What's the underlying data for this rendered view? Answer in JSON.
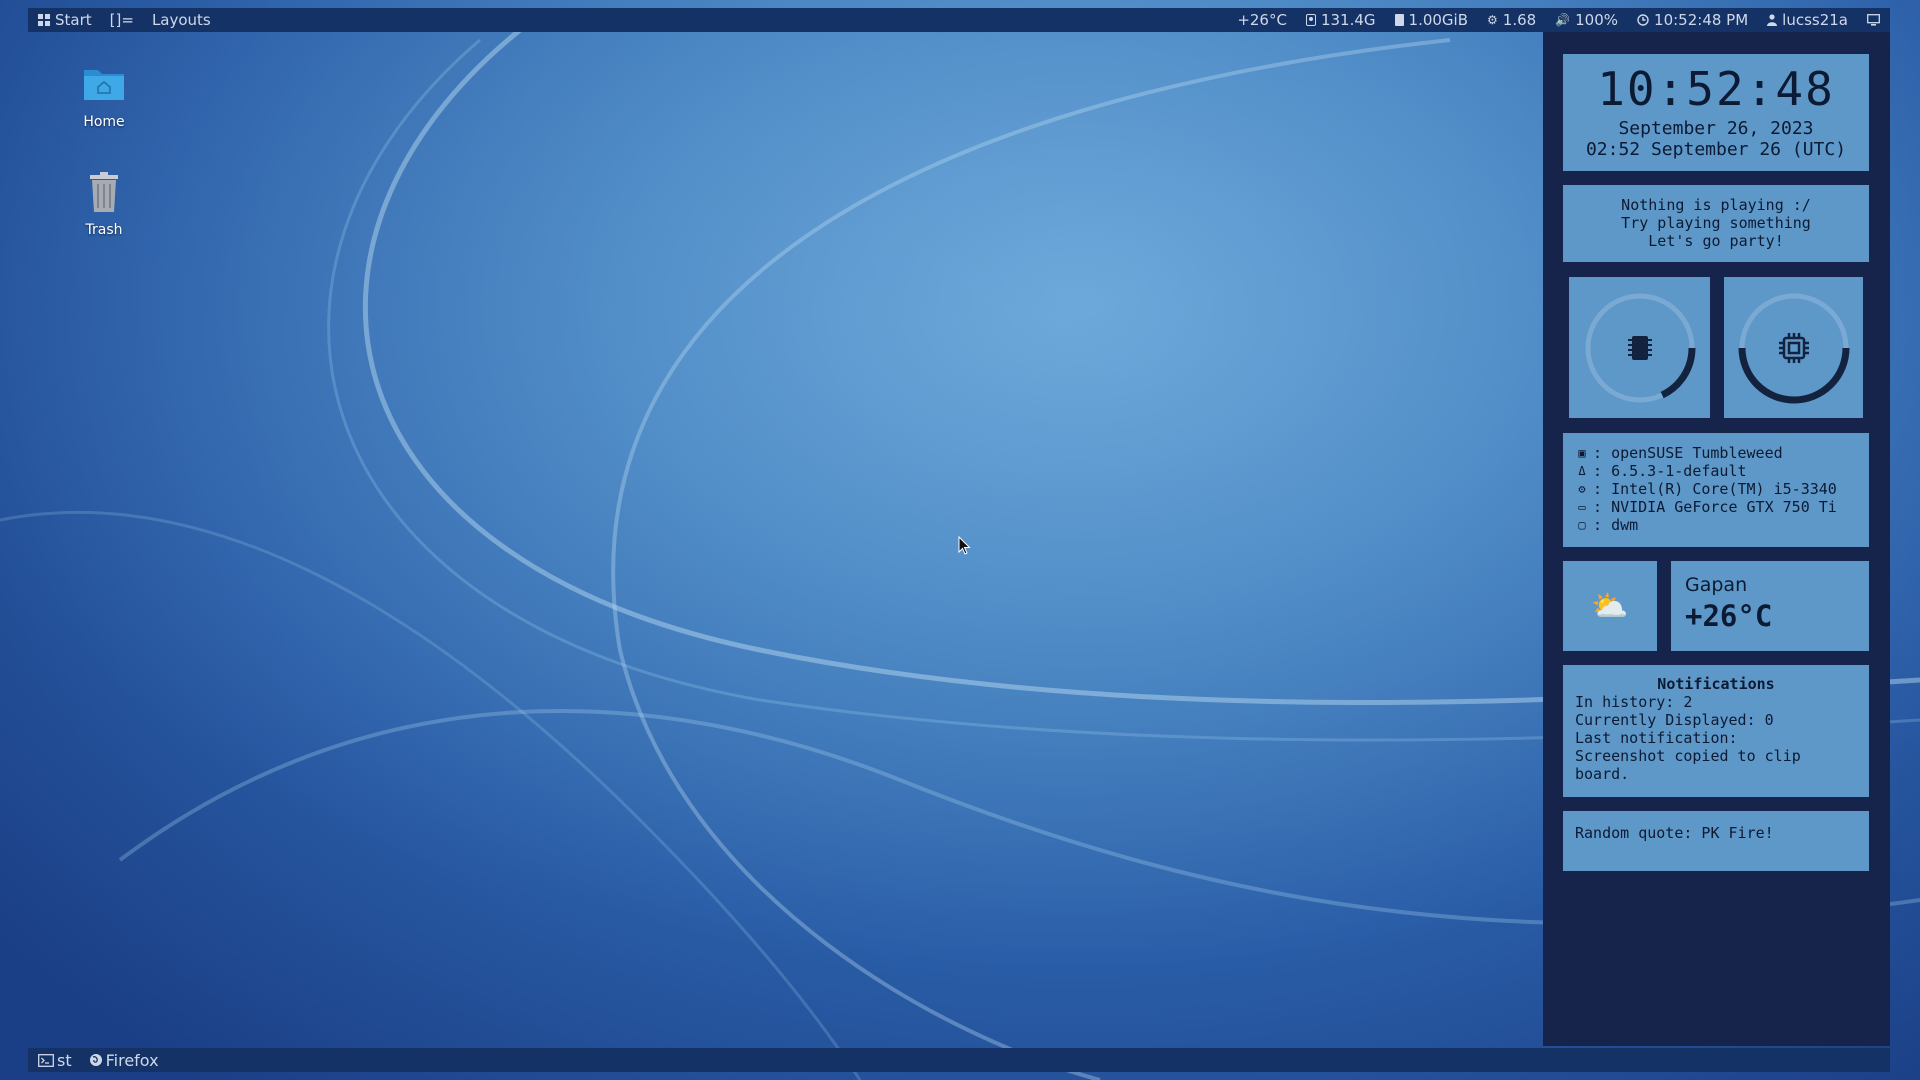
{
  "topbar": {
    "start_label": "Start",
    "layout_symbol": "[]=",
    "layouts_label": "Layouts",
    "temperature": "+26°C",
    "disk": "131.4G",
    "memory": "1.00GiB",
    "load": "1.68",
    "volume": "100%",
    "time": "10:52:48 PM",
    "user": "lucss21a"
  },
  "desktop": {
    "icons": [
      {
        "label": "Home",
        "icon": "folder-home-icon"
      },
      {
        "label": "Trash",
        "icon": "trash-icon"
      }
    ]
  },
  "panel": {
    "clock": {
      "time": "10:52:48",
      "date": "September 26, 2023",
      "utc": "02:52 September 26 (UTC)"
    },
    "music": {
      "line1": "Nothing is playing :/",
      "line2": "Try playing something",
      "line3": "Let's go party!"
    },
    "gauges": {
      "ram_fraction": 0.18,
      "cpu_fraction": 0.5
    },
    "sysinfo": {
      "separator": ":",
      "os": "openSUSE Tumbleweed",
      "kernel": "6.5.3-1-default",
      "cpu": "Intel(R) Core(TM) i5-3340",
      "gpu": "NVIDIA GeForce GTX 750 Ti",
      "wm": "dwm"
    },
    "weather": {
      "icon": "⛅",
      "city": "Gapan",
      "temp": "+26°C"
    },
    "notifications": {
      "title": "Notifications",
      "history": "In history: 2",
      "displayed": "Currently Displayed: 0",
      "last_label": "Last notification:",
      "last_line1": "Screenshot copied to clip",
      "last_line2": "board."
    },
    "quote": "Random quote: PK Fire!"
  },
  "bottombar": {
    "tasks": [
      {
        "label": "st",
        "icon": "terminal-icon"
      },
      {
        "label": "Firefox",
        "icon": "firefox-icon"
      }
    ]
  },
  "colors": {
    "bar_bg": "#153266",
    "panel_bg": "#16234a",
    "widget_bg": "#5e98c8",
    "widget_text": "#0d1a33"
  }
}
